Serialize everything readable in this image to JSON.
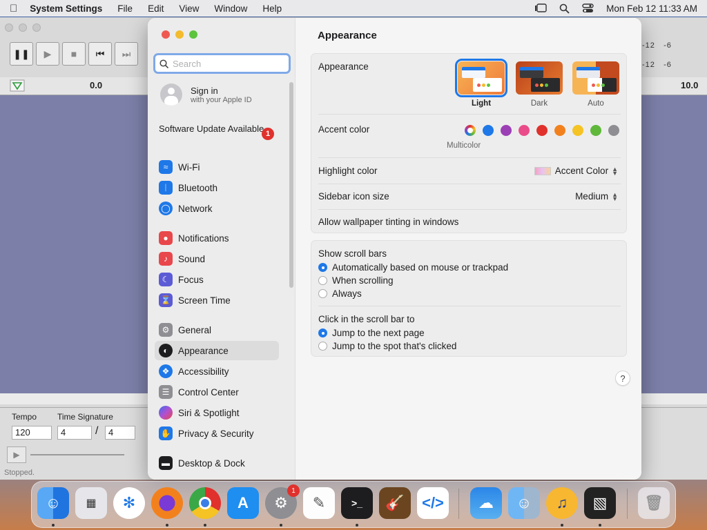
{
  "menubar": {
    "app": "System Settings",
    "menus": [
      "File",
      "Edit",
      "View",
      "Window",
      "Help"
    ],
    "clock": "Mon Feb 12  11:33 AM"
  },
  "background_app": {
    "left_time": "0.0",
    "right_time": "10.0",
    "meter_ticks": [
      "-12",
      "-6"
    ],
    "tempo_label": "Tempo",
    "tempo_value": "120",
    "time_sig_label": "Time Signature",
    "time_sig_num": "4",
    "time_sig_slash": "/",
    "time_sig_den": "4",
    "status": "Stopped."
  },
  "sidebar": {
    "search_placeholder": "Search",
    "signin_title": "Sign in",
    "signin_sub": "with your Apple ID",
    "update_label": "Software Update Available",
    "update_badge": "1",
    "items": [
      {
        "label": "Wi-Fi",
        "color": "#1e78e8"
      },
      {
        "label": "Bluetooth",
        "color": "#1e78e8"
      },
      {
        "label": "Network",
        "color": "#1e78e8"
      },
      {
        "label": "Notifications",
        "color": "#e8474b"
      },
      {
        "label": "Sound",
        "color": "#e8474b"
      },
      {
        "label": "Focus",
        "color": "#5b5bd6"
      },
      {
        "label": "Screen Time",
        "color": "#5b5bd6"
      },
      {
        "label": "General",
        "color": "#8e8e93"
      },
      {
        "label": "Appearance",
        "color": "#1d1d1f"
      },
      {
        "label": "Accessibility",
        "color": "#1e78e8"
      },
      {
        "label": "Control Center",
        "color": "#8e8e93"
      },
      {
        "label": "Siri & Spotlight",
        "color": "#b050d0"
      },
      {
        "label": "Privacy & Security",
        "color": "#1e78e8"
      },
      {
        "label": "Desktop & Dock",
        "color": "#1d1d1f"
      }
    ]
  },
  "main": {
    "title": "Appearance",
    "appearance_label": "Appearance",
    "themes": [
      "Light",
      "Dark",
      "Auto"
    ],
    "accent_label": "Accent color",
    "accent_caption": "Multicolor",
    "accent_colors": [
      "#1e78e8",
      "#9b3fb5",
      "#ea4c8a",
      "#e0312c",
      "#f2811d",
      "#f5c323",
      "#5fb83a",
      "#8e8e93"
    ],
    "highlight_label": "Highlight color",
    "highlight_value": "Accent Color",
    "icon_size_label": "Sidebar icon size",
    "icon_size_value": "Medium",
    "tinting_label": "Allow wallpaper tinting in windows",
    "scrollbars_label": "Show scroll bars",
    "scrollbars_options": [
      "Automatically based on mouse or trackpad",
      "When scrolling",
      "Always"
    ],
    "click_label": "Click in the scroll bar to",
    "click_options": [
      "Jump to the next page",
      "Jump to the spot that's clicked"
    ],
    "help": "?"
  },
  "dock": {
    "badge": "1"
  }
}
